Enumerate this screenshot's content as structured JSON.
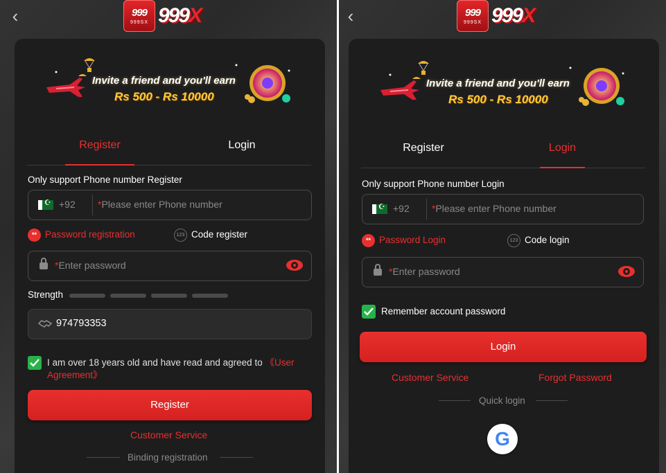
{
  "logo": {
    "badge_top": "999",
    "badge_bottom": "999SX",
    "wordmark": "999",
    "wordmark_x": "X"
  },
  "banner": {
    "line1": "Invite a friend and you'll earn",
    "line2": "Rs 500 - Rs 10000"
  },
  "left": {
    "tabs": {
      "register": "Register",
      "login": "Login",
      "active": "register"
    },
    "section_label": "Only support Phone number Register",
    "phone": {
      "country_code": "+92",
      "required_mark": "*",
      "placeholder": "Please enter Phone number"
    },
    "modes": {
      "primary": "Password registration",
      "secondary": "Code register",
      "primary_icon": "**",
      "secondary_icon": "123"
    },
    "password": {
      "required_mark": "*",
      "placeholder": "Enter password"
    },
    "strength_label": "Strength",
    "invite_code": "974793353",
    "agreement": {
      "text": "I am over 18 years old and have read and agreed to ",
      "link": "《User Agreement》"
    },
    "submit_label": "Register",
    "customer_service": "Customer Service",
    "divider_label": "Binding registration"
  },
  "right": {
    "tabs": {
      "register": "Register",
      "login": "Login",
      "active": "login"
    },
    "section_label": "Only support Phone number Login",
    "phone": {
      "country_code": "+92",
      "required_mark": "*",
      "placeholder": "Please enter Phone number"
    },
    "modes": {
      "primary": "Password Login",
      "secondary": "Code login",
      "primary_icon": "**",
      "secondary_icon": "123"
    },
    "password": {
      "required_mark": "*",
      "placeholder": "Enter password"
    },
    "remember_label": "Remember account password",
    "submit_label": "Login",
    "customer_service": "Customer Service",
    "forgot_password": "Forgot Password",
    "divider_label": "Quick login",
    "google_glyph": "G"
  },
  "colors": {
    "accent": "#e8302e",
    "check": "#28b34a",
    "card": "#1d1d1e"
  }
}
